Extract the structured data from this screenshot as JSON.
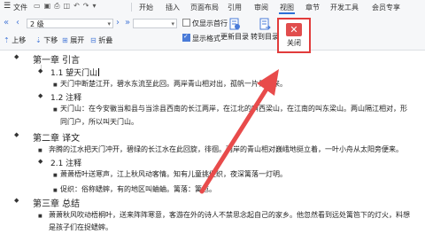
{
  "menubar": {
    "file": "文件",
    "items": [
      "开始",
      "插入",
      "页面布局",
      "引用",
      "审阅",
      "视图",
      "章节",
      "开发工具",
      "会员专享"
    ]
  },
  "toolbar": {
    "level_value": "2 级",
    "upgrade": "上移",
    "downgrade": "下移",
    "expand": "展开",
    "collapse": "折叠",
    "first_line_only": "仅显示首行",
    "show_format": "显示格式",
    "update_toc": "更新目录",
    "goto_toc": "转到目录",
    "close": "关闭"
  },
  "doc": {
    "ch1": "第一章 引言",
    "s11": "1.1 望天门山",
    "p11": "天门中断楚江开，碧水东流至此回。两岸青山相对出，孤帆一片日边来。",
    "s12": "1.2 注释",
    "p12a": "天门山：在今安徽当和县与当涂县西南的长江两岸，在江北的叫西梁山，在江南的叫东梁山。两山隔江相对，形",
    "p12b": "同门户，所以叫天门山。",
    "ch2": "第二章 译文",
    "p2": "奔腾的江水把天门冲开，碧绿的长江水在此回旋，徘徊。两岸的青山相对巍峨地挺立着，一叶小舟从太阳旁便来。",
    "s21": "2.1 注释",
    "p21a": "萧萧梧叶送寒声，江上秋风动客情。知有儿童挑促织，夜深篱落一灯明。",
    "p21b": "促织：俗称蟋蟀，有的地区叫蛐蛐。篱落：篱笆。",
    "ch3": "第三章 总结",
    "p3a": "萧萧秋风吹动梧桐叶，送来阵阵寒意，客游在外的诗人不禁思念起自己的家乡。他忽然看到远处篱笆下的灯火，料想",
    "p3b": "是孩子们在捉蟋蟀。"
  },
  "colors": {
    "accent": "#e13b3b",
    "arrow": "#e84b4b"
  }
}
